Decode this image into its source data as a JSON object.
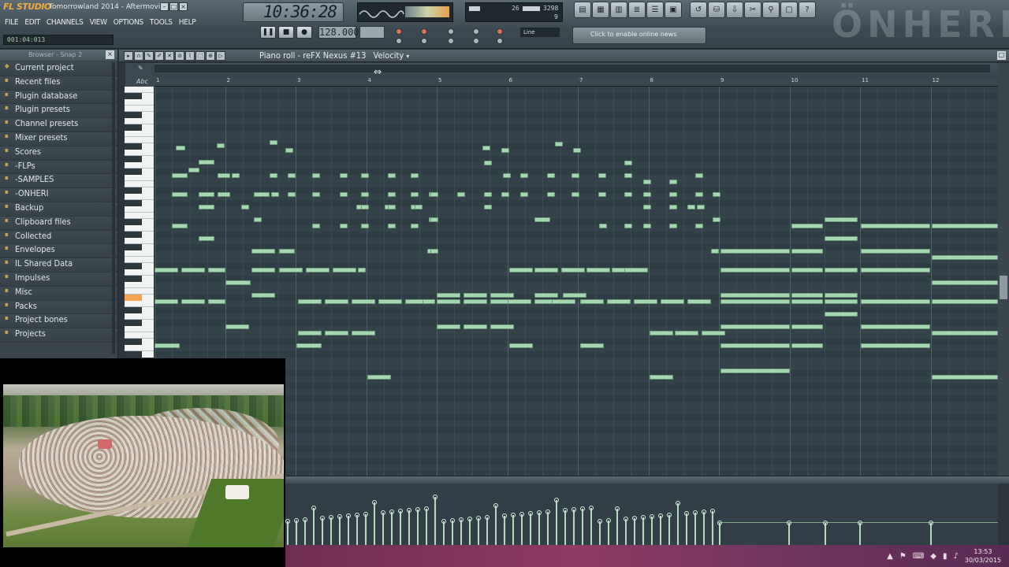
{
  "app": {
    "brand": "FL STUDIO",
    "window_title": "Tomorrowland 2014 - Aftermovi..."
  },
  "menu": [
    "FILE",
    "EDIT",
    "CHANNELS",
    "VIEW",
    "OPTIONS",
    "TOOLS",
    "HELP"
  ],
  "song_position": "001:04:013",
  "clock": "10:36:28",
  "cpu": {
    "value_left": "26",
    "value_right": "3298",
    "value_right2": "9"
  },
  "transport": {
    "tempo": "128.000",
    "line_mode": "Line",
    "news_text": "Click to enable online news"
  },
  "watermark": "ÖNHERI",
  "browser": {
    "header": "Browser - Snap 2",
    "items": [
      {
        "label": "Current project",
        "icon": "project-icon"
      },
      {
        "label": "Recent files",
        "icon": "folder-icon"
      },
      {
        "label": "Plugin database",
        "icon": "folder-icon"
      },
      {
        "label": "Plugin presets",
        "icon": "folder-icon"
      },
      {
        "label": "Channel presets",
        "icon": "folder-icon"
      },
      {
        "label": "Mixer presets",
        "icon": "folder-icon"
      },
      {
        "label": "Scores",
        "icon": "folder-icon"
      },
      {
        "label": "-FLPs",
        "icon": "folder-icon"
      },
      {
        "label": "-SAMPLES",
        "icon": "folder-icon"
      },
      {
        "label": "-ONHERI",
        "icon": "folder-icon"
      },
      {
        "label": "Backup",
        "icon": "folder-icon"
      },
      {
        "label": "Clipboard files",
        "icon": "folder-icon"
      },
      {
        "label": "Collected",
        "icon": "folder-icon"
      },
      {
        "label": "Envelopes",
        "icon": "folder-icon"
      },
      {
        "label": "IL Shared Data",
        "icon": "folder-icon"
      },
      {
        "label": "Impulses",
        "icon": "folder-icon"
      },
      {
        "label": "Misc",
        "icon": "folder-icon"
      },
      {
        "label": "Packs",
        "icon": "folder-icon"
      },
      {
        "label": "Project bones",
        "icon": "folder-icon"
      },
      {
        "label": "Projects",
        "icon": "folder-icon"
      }
    ]
  },
  "piano_roll": {
    "title": "Piano roll - reFX Nexus #13",
    "target": "Velocity",
    "bars": [
      "1",
      "2",
      "3",
      "4",
      "5",
      "6",
      "7",
      "8",
      "9",
      "10",
      "11",
      "12"
    ],
    "key_label": "Abc"
  },
  "taskbar": {
    "time": "13:53",
    "date": "30/03/2015"
  },
  "colors": {
    "note": "#a6d7b3",
    "grid_bg": "#34434a",
    "taskbar": "#8e3a63",
    "accent": "#f2a93b"
  }
}
